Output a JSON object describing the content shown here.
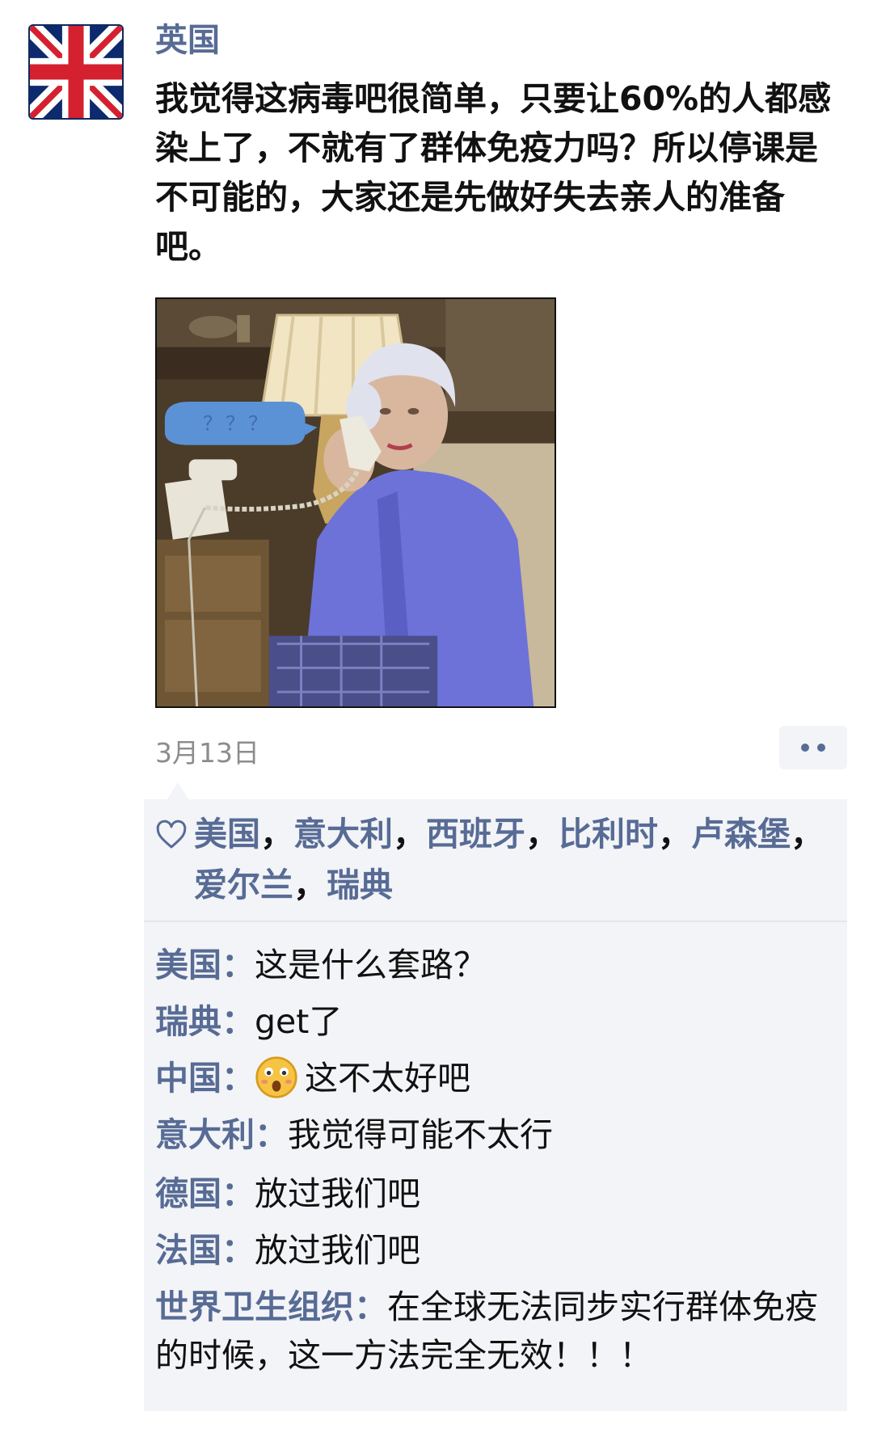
{
  "post": {
    "author": "英国",
    "avatar_icon": "uk-flag-icon",
    "text": "我觉得这病毒吧很简单，只要让60%的人都感染上了，不就有了群体免疫力吗？所以停课是不可能的，大家还是先做好失去亲人的准备吧。",
    "image": {
      "speech_bubble_text": "？？？",
      "bubble_color": "#5b92d6"
    },
    "timestamp": "3月13日",
    "more_icon": "more-dots-icon"
  },
  "likes": {
    "icon": "heart-icon",
    "names": [
      "美国",
      "意大利",
      "西班牙",
      "比利时",
      "卢森堡",
      "爱尔兰",
      "瑞典"
    ],
    "separator": "，"
  },
  "comments": [
    {
      "author": "美国：",
      "text": "这是什么套路？"
    },
    {
      "author": "瑞典：",
      "text": "get了"
    },
    {
      "author": "中国：",
      "emoji": "surprised-face-icon",
      "text": "这不太好吧"
    },
    {
      "author": "意大利：",
      "text": "我觉得可能不太行"
    },
    {
      "author": "德国：",
      "text": "放过我们吧"
    },
    {
      "author": "法国：",
      "text": "放过我们吧"
    },
    {
      "author": "世界卫生组织：",
      "text": "在全球无法同步实行群体免疫的时候，这一方法完全无效！！！"
    }
  ],
  "colors": {
    "link": "#576b95",
    "panel": "#f3f4f7",
    "timestamp": "#8c8c8c"
  }
}
